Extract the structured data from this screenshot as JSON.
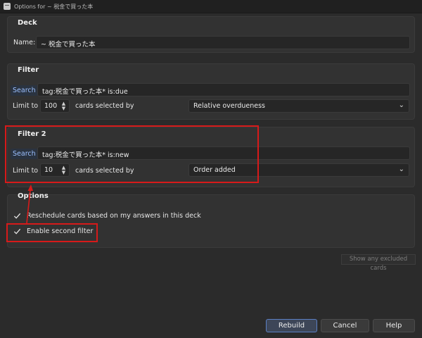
{
  "window": {
    "title": "Options for ~ 税金で買った本"
  },
  "deck": {
    "title": "Deck",
    "name_label": "Name:",
    "name_value": "~ 税金で買った本"
  },
  "filter1": {
    "title": "Filter",
    "search_label": "Search",
    "search_value": "tag:税金で買った本* is:due",
    "limit_label": "Limit to",
    "limit_value": "100",
    "cards_label": "cards selected by",
    "order_value": "Relative overdueness"
  },
  "filter2": {
    "title": "Filter 2",
    "search_label": "Search",
    "search_value": "tag:税金で買った本* is:new",
    "limit_label": "Limit to",
    "limit_value": "10",
    "cards_label": "cards selected by",
    "order_value": "Order added"
  },
  "options": {
    "title": "Options",
    "reschedule_label": "Reschedule cards based on my answers in this deck",
    "reschedule_checked": true,
    "second_filter_label": "Enable second filter",
    "second_filter_checked": true
  },
  "show_excluded_label": "Show any excluded cards",
  "buttons": {
    "rebuild": "Rebuild",
    "cancel": "Cancel",
    "help": "Help"
  },
  "annotation": {
    "color": "#d71a1a"
  }
}
